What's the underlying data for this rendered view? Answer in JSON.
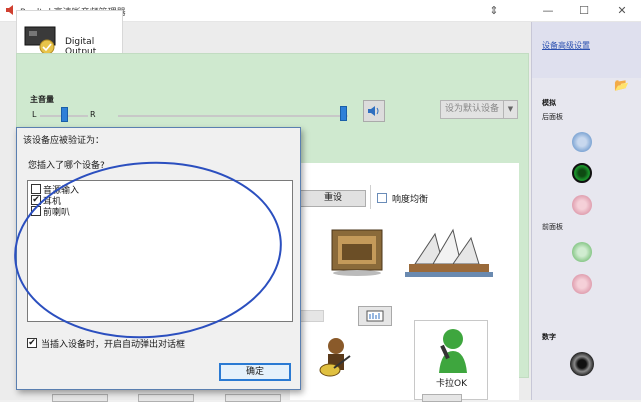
{
  "window": {
    "title": "Realtek高清晰音频管理器"
  },
  "device_tab": {
    "label": "Digital Output"
  },
  "volume": {
    "label": "主音量",
    "left": "L",
    "right": "R",
    "set_default_label": "设为默认设备"
  },
  "effects": {
    "reset_label": "重设",
    "loudness_label": "响度均衡"
  },
  "karaoke": {
    "label": "卡拉OK"
  },
  "side_panel": {
    "advanced_link": "设备高级设置",
    "analog_label": "模拟",
    "back_panel_label": "后面板",
    "front_panel_label": "前面板",
    "digital_label": "数字"
  },
  "dialog": {
    "title": "该设备应被验证为：",
    "question": "您插入了哪个设备?",
    "options": [
      {
        "label": "音源输入",
        "checked": false
      },
      {
        "label": "耳机",
        "checked": true
      },
      {
        "label": "前喇叭",
        "checked": false
      }
    ],
    "auto_popup_label": "当插入设备时，开启自动弹出对话框",
    "auto_popup_checked": true,
    "ok_label": "确定"
  },
  "colors": {
    "green_panel": "#cfe9cf",
    "annotation": "#2b4fbf",
    "jack_blue": "#7fa6d4",
    "jack_green": "#1a8f2a",
    "jack_pink": "#e0a0b0"
  }
}
